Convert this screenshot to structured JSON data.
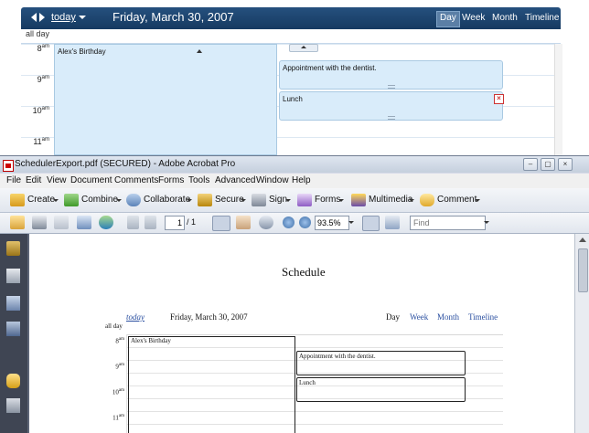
{
  "scheduler": {
    "today_label": "today",
    "date": "Friday, March 30, 2007",
    "views": [
      "Day",
      "Week",
      "Month",
      "Timeline"
    ],
    "active_view": "Day",
    "all_day_label": "all day",
    "hours": [
      {
        "h": "8",
        "suffix": "am"
      },
      {
        "h": "9",
        "suffix": "am"
      },
      {
        "h": "10",
        "suffix": "am"
      },
      {
        "h": "11",
        "suffix": "am"
      }
    ],
    "appointments": {
      "birthday": "Alex's Birthday",
      "dentist": "Appointment with the dentist.",
      "lunch": "Lunch"
    },
    "delete_glyph": "×"
  },
  "acrobat": {
    "title": "SchedulerExport.pdf (SECURED) - Adobe Acrobat Pro",
    "window_buttons": {
      "minimize": "–",
      "restore": "▢",
      "close": "×"
    },
    "menu": [
      "File",
      "Edit",
      "View",
      "Document",
      "Comments",
      "Forms",
      "Tools",
      "Advanced",
      "Window",
      "Help"
    ],
    "tasks": {
      "create": "Create",
      "combine": "Combine",
      "collaborate": "Collaborate",
      "secure": "Secure",
      "sign": "Sign",
      "forms": "Forms",
      "multimedia": "Multimedia",
      "comment": "Comment"
    },
    "nav": {
      "page_current": "1",
      "page_total": "/ 1",
      "zoom": "93.5%",
      "find_placeholder": "Find"
    },
    "colors": {
      "titlebar": "#c5cfdd",
      "rail": "#3f4553",
      "doc_bg": "#5d6577",
      "accent": "#2a4fa0"
    }
  },
  "pdf": {
    "heading": "Schedule",
    "today_label": "today",
    "date": "Friday, March 30, 2007",
    "views": [
      "Day",
      "Week",
      "Month",
      "Timeline"
    ],
    "all_day_label": "all day",
    "hours": [
      {
        "h": "8",
        "suffix": "am"
      },
      {
        "h": "9",
        "suffix": "am"
      },
      {
        "h": "10",
        "suffix": "am"
      },
      {
        "h": "11",
        "suffix": "am"
      }
    ],
    "appointments": {
      "birthday": "Alex's Birthday",
      "dentist": "Appointment with the dentist.",
      "lunch": "Lunch"
    }
  }
}
